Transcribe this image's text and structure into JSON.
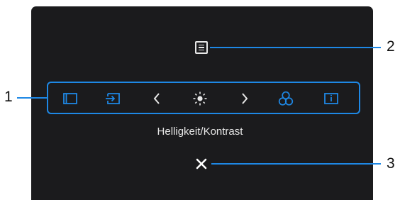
{
  "osd": {
    "caption": "Helligkeit/Kontrast",
    "toolbar_icons": [
      "preset-mode-icon",
      "input-source-icon",
      "chevron-left-icon",
      "brightness-icon",
      "chevron-right-icon",
      "color-icon",
      "info-icon"
    ],
    "selected_icon": "brightness-icon"
  },
  "callouts": {
    "one": "1",
    "two": "2",
    "three": "3"
  },
  "colors": {
    "panel_bg": "#1b1b1d",
    "accent_blue": "#1e88e5",
    "icon_white": "#e8e8e8"
  }
}
